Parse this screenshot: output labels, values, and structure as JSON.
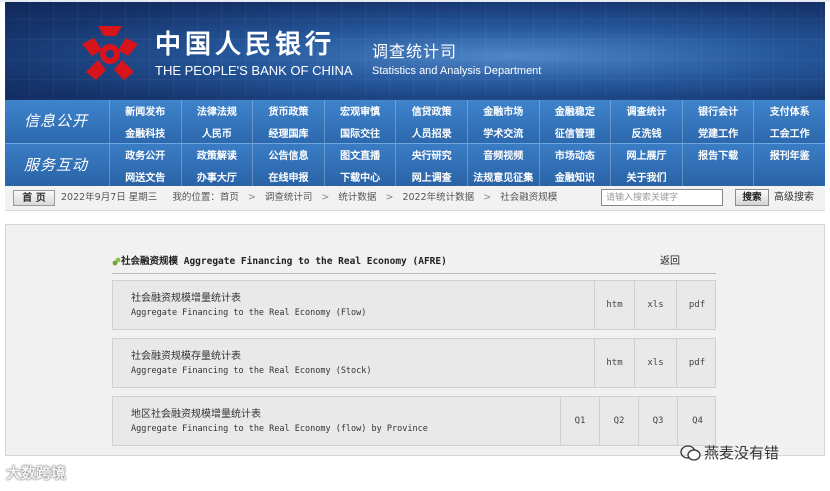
{
  "header": {
    "bank_name_cn": "中国人民银行",
    "bank_name_en": "THE PEOPLE'S BANK OF CHINA",
    "dept_cn": "调查统计司",
    "dept_en": "Statistics and Analysis Department",
    "logo_color": "#d8141b"
  },
  "nav": {
    "section1_title": "信息公开",
    "section1_items": [
      "新闻发布",
      "法律法规",
      "货币政策",
      "宏观审慎",
      "信贷政策",
      "金融市场",
      "金融稳定",
      "调查统计",
      "银行会计",
      "支付体系",
      "金融科技",
      "人民币",
      "经理国库",
      "国际交往",
      "人员招录",
      "学术交流",
      "征信管理",
      "反洗钱",
      "党建工作",
      "工会工作"
    ],
    "section2_title": "服务互动",
    "section2_items": [
      "政务公开",
      "政策解读",
      "公告信息",
      "图文直播",
      "央行研究",
      "音频视频",
      "市场动态",
      "网上展厅",
      "报告下载",
      "报刊年鉴",
      "网送文告",
      "办事大厅",
      "在线申报",
      "下载中心",
      "网上调查",
      "法规意见征集",
      "金融知识",
      "关于我们",
      "",
      ""
    ]
  },
  "breadcrumb": {
    "home_label": "首 页",
    "date": "2022年9月7日 星期三",
    "location_label": "我的位置：首页",
    "crumbs": [
      "调查统计司",
      "统计数据",
      "2022年统计数据",
      "社会融资规模"
    ],
    "search_placeholder": "请输入搜索关键字",
    "search_button": "搜索",
    "advanced_search": "高级搜索"
  },
  "content": {
    "section_title": "社会融资规模 Aggregate Financing to the Real Economy (AFRE)",
    "back_label": "返回",
    "rows": [
      {
        "title_cn": "社会融资规模增量统计表",
        "title_en": "Aggregate Financing to the Real Economy (Flow)",
        "links": [
          "htm",
          "xls",
          "pdf"
        ]
      },
      {
        "title_cn": "社会融资规模存量统计表",
        "title_en": "Aggregate Financing to the Real Economy (Stock)",
        "links": [
          "htm",
          "xls",
          "pdf"
        ]
      },
      {
        "title_cn": "地区社会融资规模增量统计表",
        "title_en": "Aggregate Financing to the Real Economy (flow) by Province",
        "links": [
          "Q1",
          "Q2",
          "Q3",
          "Q4"
        ]
      }
    ]
  },
  "watermarks": {
    "left": "大数跨境",
    "right": "燕麦没有错"
  }
}
